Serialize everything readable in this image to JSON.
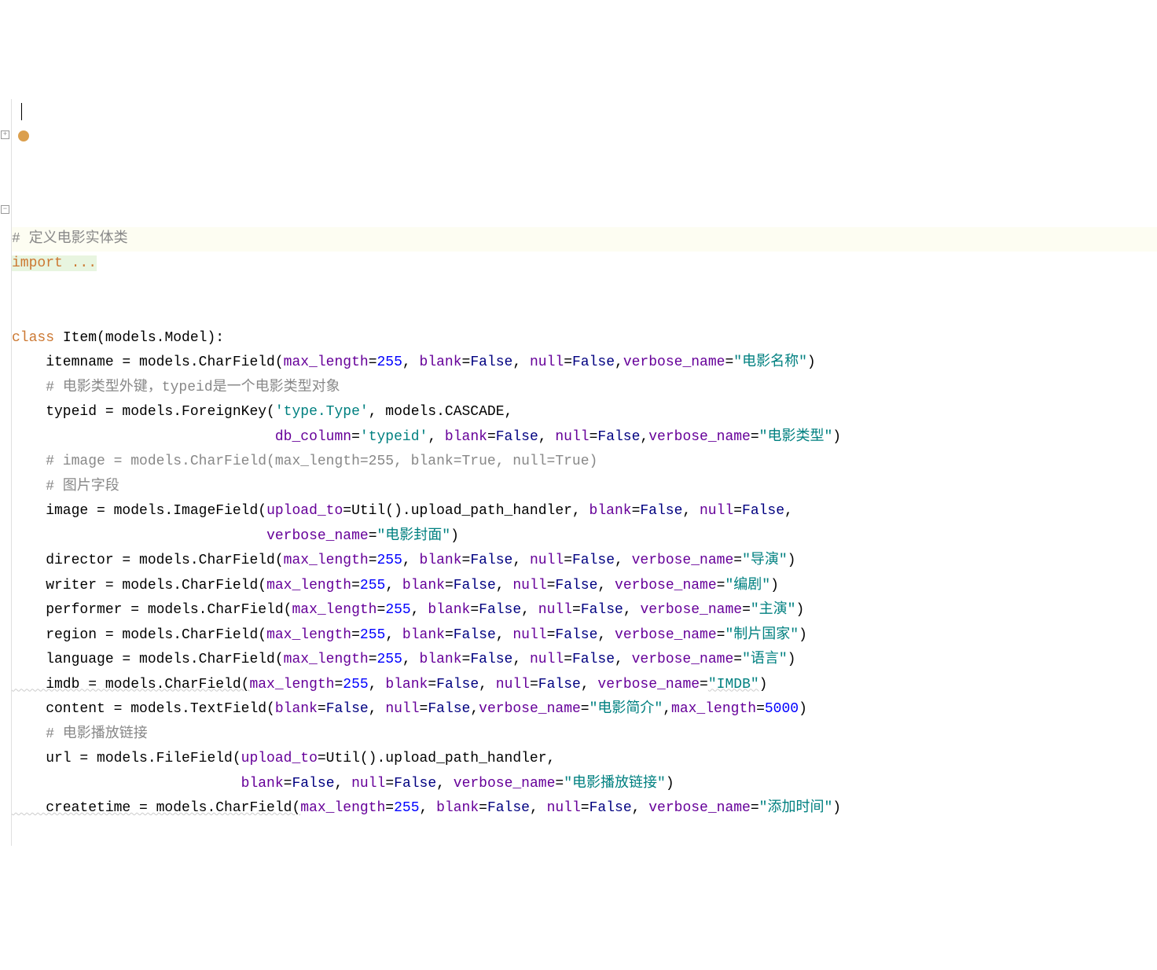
{
  "code": {
    "line1_comment": "# 定义电影实体类",
    "line2_import": "import ...",
    "line5_class": "class",
    "line5_classname": " Item(models.Model):",
    "line6_pre": "    itemname = models.CharField(",
    "line6_p1": "max_length",
    "line6_eq1": "=",
    "line6_v1": "255",
    "line6_c1": ", ",
    "line6_p2": "blank",
    "line6_eq2": "=",
    "line6_v2": "False",
    "line6_c2": ", ",
    "line6_p3": "null",
    "line6_eq3": "=",
    "line6_v3": "False",
    "line6_c3": ",",
    "line6_p4": "verbose_name",
    "line6_eq4": "=",
    "line6_v4": "\"电影名称\"",
    "line6_end": ")",
    "line7_comment": "    # 电影类型外键，typeid是一个电影类型对象",
    "line8_pre": "    typeid = models.ForeignKey(",
    "line8_s1": "'type.Type'",
    "line8_c1": ", models.CASCADE,",
    "line9_pre": "                               ",
    "line9_p1": "db_column",
    "line9_eq1": "=",
    "line9_s1": "'typeid'",
    "line9_c1": ", ",
    "line9_p2": "blank",
    "line9_eq2": "=",
    "line9_v2": "False",
    "line9_c2": ", ",
    "line9_p3": "null",
    "line9_eq3": "=",
    "line9_v3": "False",
    "line9_c3": ",",
    "line9_p4": "verbose_name",
    "line9_eq4": "=",
    "line9_v4": "\"电影类型\"",
    "line9_end": ")",
    "line10_comment": "    # image = models.CharField(max_length=255, blank=True, null=True)",
    "line11_comment": "    # 图片字段",
    "line12_pre": "    image = models.ImageField(",
    "line12_p1": "upload_to",
    "line12_eq1": "=Util().upload_path_handler, ",
    "line12_p2": "blank",
    "line12_eq2": "=",
    "line12_v2": "False",
    "line12_c2": ", ",
    "line12_p3": "null",
    "line12_eq3": "=",
    "line12_v3": "False",
    "line12_end": ",",
    "line13_pre": "                              ",
    "line13_p1": "verbose_name",
    "line13_eq1": "=",
    "line13_v1": "\"电影封面\"",
    "line13_end": ")",
    "line14_pre": "    director = models.CharField(",
    "line14_p1": "max_length",
    "line14_eq1": "=",
    "line14_v1": "255",
    "line14_c1": ", ",
    "line14_p2": "blank",
    "line14_eq2": "=",
    "line14_v2": "False",
    "line14_c2": ", ",
    "line14_p3": "null",
    "line14_eq3": "=",
    "line14_v3": "False",
    "line14_c3": ", ",
    "line14_p4": "verbose_name",
    "line14_eq4": "=",
    "line14_v4": "\"导演\"",
    "line14_end": ")",
    "line15_pre": "    writer = models.CharField(",
    "line15_p1": "max_length",
    "line15_eq1": "=",
    "line15_v1": "255",
    "line15_c1": ", ",
    "line15_p2": "blank",
    "line15_eq2": "=",
    "line15_v2": "False",
    "line15_c2": ", ",
    "line15_p3": "null",
    "line15_eq3": "=",
    "line15_v3": "False",
    "line15_c3": ", ",
    "line15_p4": "verbose_name",
    "line15_eq4": "=",
    "line15_v4": "\"编剧\"",
    "line15_end": ")",
    "line16_pre": "    performer = models.CharField(",
    "line16_p1": "max_length",
    "line16_eq1": "=",
    "line16_v1": "255",
    "line16_c1": ", ",
    "line16_p2": "blank",
    "line16_eq2": "=",
    "line16_v2": "False",
    "line16_c2": ", ",
    "line16_p3": "null",
    "line16_eq3": "=",
    "line16_v3": "False",
    "line16_c3": ", ",
    "line16_p4": "verbose_name",
    "line16_eq4": "=",
    "line16_v4": "\"主演\"",
    "line16_end": ")",
    "line17_pre": "    region = models.CharField(",
    "line17_p1": "max_length",
    "line17_eq1": "=",
    "line17_v1": "255",
    "line17_c1": ", ",
    "line17_p2": "blank",
    "line17_eq2": "=",
    "line17_v2": "False",
    "line17_c2": ", ",
    "line17_p3": "null",
    "line17_eq3": "=",
    "line17_v3": "False",
    "line17_c3": ", ",
    "line17_p4": "verbose_name",
    "line17_eq4": "=",
    "line17_v4": "\"制片国家\"",
    "line17_end": ")",
    "line18_pre": "    language = models.CharField(",
    "line18_p1": "max_length",
    "line18_eq1": "=",
    "line18_v1": "255",
    "line18_c1": ", ",
    "line18_p2": "blank",
    "line18_eq2": "=",
    "line18_v2": "False",
    "line18_c2": ", ",
    "line18_p3": "null",
    "line18_eq3": "=",
    "line18_v3": "False",
    "line18_c3": ", ",
    "line18_p4": "verbose_name",
    "line18_eq4": "=",
    "line18_v4": "\"语言\"",
    "line18_end": ")",
    "line19_pre": "    imdb = models.CharField(",
    "line19_p1": "max_length",
    "line19_eq1": "=",
    "line19_v1": "255",
    "line19_c1": ", ",
    "line19_p2": "blank",
    "line19_eq2": "=",
    "line19_v2": "False",
    "line19_c2": ", ",
    "line19_p3": "null",
    "line19_eq3": "=",
    "line19_v3": "False",
    "line19_c3": ", ",
    "line19_p4": "verbose_name",
    "line19_eq4": "=",
    "line19_v4": "\"IMDB\"",
    "line19_end": ")",
    "line20_pre": "    content = models.TextField(",
    "line20_p1": "blank",
    "line20_eq1": "=",
    "line20_v1": "False",
    "line20_c1": ", ",
    "line20_p2": "null",
    "line20_eq2": "=",
    "line20_v2": "False",
    "line20_c2": ",",
    "line20_p3": "verbose_name",
    "line20_eq3": "=",
    "line20_v3": "\"电影简介\"",
    "line20_c3": ",",
    "line20_p4": "max_length",
    "line20_eq4": "=",
    "line20_v4": "5000",
    "line20_end": ")",
    "line21_comment": "    # 电影播放链接",
    "line22_pre": "    url = models.FileField(",
    "line22_p1": "upload_to",
    "line22_eq1": "=Util().upload_path_handler,",
    "line23_pre": "                           ",
    "line23_p1": "blank",
    "line23_eq1": "=",
    "line23_v1": "False",
    "line23_c1": ", ",
    "line23_p2": "null",
    "line23_eq2": "=",
    "line23_v2": "False",
    "line23_c2": ", ",
    "line23_p3": "verbose_name",
    "line23_eq3": "=",
    "line23_v3": "\"电影播放链接\"",
    "line23_end": ")",
    "line24_pre": "    createtime = models.CharField(",
    "line24_p1": "max_length",
    "line24_eq1": "=",
    "line24_v1": "255",
    "line24_c1": ", ",
    "line24_p2": "blank",
    "line24_eq2": "=",
    "line24_v2": "False",
    "line24_c2": ", ",
    "line24_p3": "null",
    "line24_eq3": "=",
    "line24_v3": "False",
    "line24_c3": ", ",
    "line24_p4": "verbose_name",
    "line24_eq4": "=",
    "line24_v4": "\"添加时间\"",
    "line24_end": ")"
  }
}
